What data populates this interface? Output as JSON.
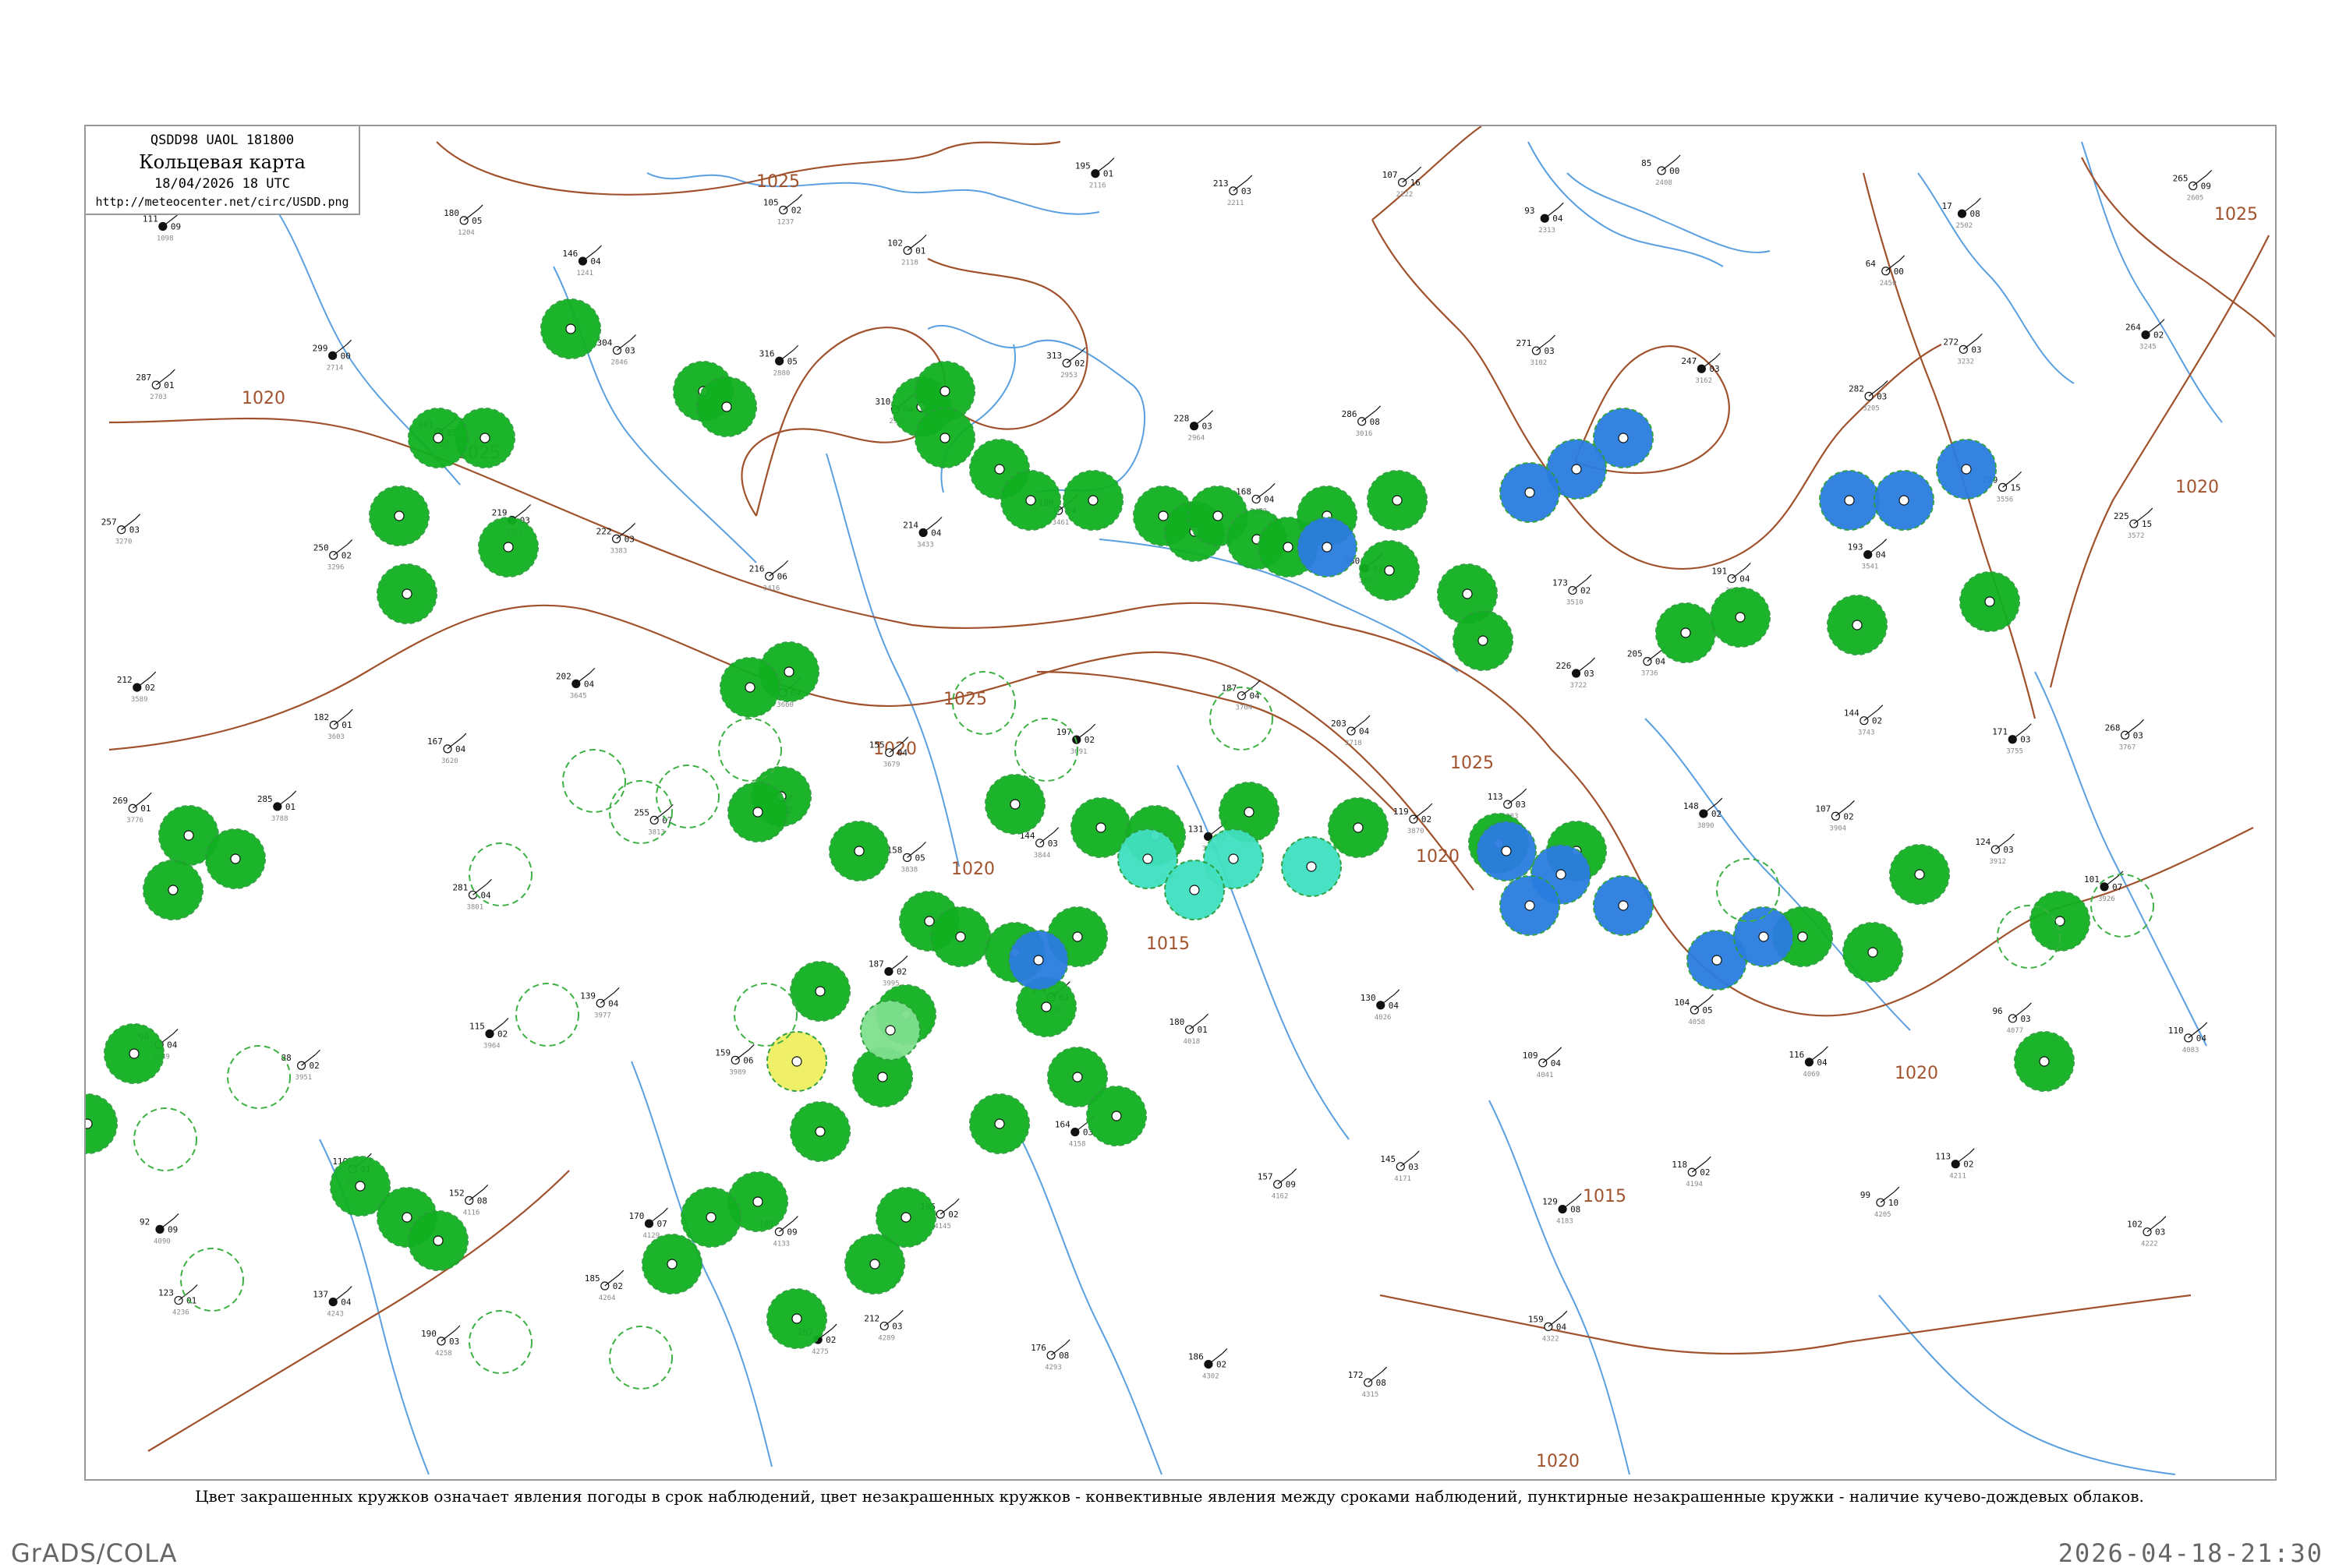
{
  "header": {
    "code": "QSDD98  UAOL  181800",
    "title": "Кольцевая карта",
    "date": "18/04/2026 18 UTC",
    "url": "http://meteocenter.net/circ/USDD.png"
  },
  "caption": "Цвет закрашенных кружков означает явления погоды в срок наблюдений, цвет незакрашенных кружков - конвективные явления между сроками наблюдений, пунктирные незакрашенные кружки - наличие кучево-дождевых облаков.",
  "footer": {
    "left": "GrADS/COLA",
    "right": "2026-04-18-21:30"
  },
  "colors": {
    "isobar": "#a0522d",
    "river": "#5aa0e0",
    "green": "#10b020",
    "blue": "#2a7de0",
    "cyan": "#40e0c0",
    "yellow": "#f0f060",
    "lightgreen": "#80e090"
  },
  "isobar_labels": [
    "1025",
    "1020",
    "1025",
    "1025",
    "1020",
    "1025",
    "1020",
    "1015",
    "1020",
    "1025",
    "1020",
    "1015",
    "1020",
    "1020"
  ],
  "stations": [
    {
      "t": "111",
      "p": "09",
      "id": "1098"
    },
    {
      "t": "140",
      "p": "04",
      "id": "1152"
    },
    {
      "t": "180",
      "p": "05",
      "id": "1204"
    },
    {
      "t": "146",
      "p": "04",
      "id": "1241"
    },
    {
      "t": "105",
      "p": "02",
      "id": "1237"
    },
    {
      "t": "102",
      "p": "01",
      "id": "2118"
    },
    {
      "t": "195",
      "p": "01",
      "id": "2116"
    },
    {
      "t": "213",
      "p": "03",
      "id": "2211"
    },
    {
      "t": "107",
      "p": "16",
      "id": "2222"
    },
    {
      "t": "93",
      "p": "04",
      "id": "2313"
    },
    {
      "t": "85",
      "p": "00",
      "id": "2408"
    },
    {
      "t": "64",
      "p": "00",
      "id": "2450"
    },
    {
      "t": "17",
      "p": "08",
      "id": "2502"
    },
    {
      "t": "265",
      "p": "09",
      "id": "2605"
    },
    {
      "t": "287",
      "p": "01",
      "id": "2703"
    },
    {
      "t": "299",
      "p": "00",
      "id": "2714"
    },
    {
      "t": "301",
      "p": "05",
      "id": "2832"
    },
    {
      "t": "304",
      "p": "03",
      "id": "2846"
    },
    {
      "t": "316",
      "p": "05",
      "id": "2880"
    },
    {
      "t": "310",
      "p": "04",
      "id": "2916"
    },
    {
      "t": "313",
      "p": "02",
      "id": "2953"
    },
    {
      "t": "228",
      "p": "03",
      "id": "2964"
    },
    {
      "t": "286",
      "p": "08",
      "id": "3016"
    },
    {
      "t": "271",
      "p": "03",
      "id": "3102"
    },
    {
      "t": "247",
      "p": "03",
      "id": "3162"
    },
    {
      "t": "282",
      "p": "03",
      "id": "3205"
    },
    {
      "t": "272",
      "p": "03",
      "id": "3232"
    },
    {
      "t": "264",
      "p": "02",
      "id": "3245"
    },
    {
      "t": "257",
      "p": "03",
      "id": "3270"
    },
    {
      "t": "250",
      "p": "02",
      "id": "3296"
    },
    {
      "t": "219",
      "p": "03",
      "id": "3320"
    },
    {
      "t": "222",
      "p": "03",
      "id": "3383"
    },
    {
      "t": "216",
      "p": "06",
      "id": "3416"
    },
    {
      "t": "214",
      "p": "04",
      "id": "3433"
    },
    {
      "t": "189",
      "p": "04",
      "id": "3461"
    },
    {
      "t": "168",
      "p": "04",
      "id": "3478"
    },
    {
      "t": "160",
      "p": "03",
      "id": "3496"
    },
    {
      "t": "173",
      "p": "02",
      "id": "3510"
    },
    {
      "t": "191",
      "p": "04",
      "id": "3528"
    },
    {
      "t": "193",
      "p": "04",
      "id": "3541"
    },
    {
      "t": "229",
      "p": "15",
      "id": "3556"
    },
    {
      "t": "225",
      "p": "15",
      "id": "3572"
    },
    {
      "t": "212",
      "p": "02",
      "id": "3589"
    },
    {
      "t": "182",
      "p": "01",
      "id": "3603"
    },
    {
      "t": "167",
      "p": "04",
      "id": "3620"
    },
    {
      "t": "202",
      "p": "04",
      "id": "3645"
    },
    {
      "t": "178",
      "p": "04",
      "id": "3660"
    },
    {
      "t": "155",
      "p": "04",
      "id": "3679"
    },
    {
      "t": "197",
      "p": "02",
      "id": "3691"
    },
    {
      "t": "187",
      "p": "04",
      "id": "3704"
    },
    {
      "t": "203",
      "p": "04",
      "id": "3718"
    },
    {
      "t": "226",
      "p": "03",
      "id": "3722"
    },
    {
      "t": "205",
      "p": "04",
      "id": "3736"
    },
    {
      "t": "144",
      "p": "02",
      "id": "3743"
    },
    {
      "t": "171",
      "p": "03",
      "id": "3755"
    },
    {
      "t": "268",
      "p": "03",
      "id": "3767"
    },
    {
      "t": "269",
      "p": "01",
      "id": "3776"
    },
    {
      "t": "285",
      "p": "01",
      "id": "3788"
    },
    {
      "t": "281",
      "p": "04",
      "id": "3801"
    },
    {
      "t": "255",
      "p": "07",
      "id": "3813"
    },
    {
      "t": "163",
      "p": "02",
      "id": "3826"
    },
    {
      "t": "158",
      "p": "05",
      "id": "3838"
    },
    {
      "t": "144",
      "p": "03",
      "id": "3844"
    },
    {
      "t": "131",
      "p": "02",
      "id": "3855"
    },
    {
      "t": "119",
      "p": "02",
      "id": "3870"
    },
    {
      "t": "113",
      "p": "03",
      "id": "3883"
    },
    {
      "t": "148",
      "p": "02",
      "id": "3890"
    },
    {
      "t": "107",
      "p": "02",
      "id": "3904"
    },
    {
      "t": "124",
      "p": "03",
      "id": "3912"
    },
    {
      "t": "101",
      "p": "07",
      "id": "3926"
    },
    {
      "t": "96",
      "p": "04",
      "id": "3939"
    },
    {
      "t": "88",
      "p": "02",
      "id": "3951"
    },
    {
      "t": "115",
      "p": "02",
      "id": "3964"
    },
    {
      "t": "139",
      "p": "04",
      "id": "3977"
    },
    {
      "t": "159",
      "p": "06",
      "id": "3989"
    },
    {
      "t": "187",
      "p": "02",
      "id": "3995"
    },
    {
      "t": "174",
      "p": "01",
      "id": "4002"
    },
    {
      "t": "180",
      "p": "01",
      "id": "4018"
    },
    {
      "t": "130",
      "p": "04",
      "id": "4026"
    },
    {
      "t": "109",
      "p": "04",
      "id": "4041"
    },
    {
      "t": "104",
      "p": "05",
      "id": "4058"
    },
    {
      "t": "116",
      "p": "04",
      "id": "4069"
    },
    {
      "t": "96",
      "p": "03",
      "id": "4077"
    },
    {
      "t": "110",
      "p": "04",
      "id": "4083"
    },
    {
      "t": "92",
      "p": "09",
      "id": "4090"
    },
    {
      "t": "110",
      "p": "01",
      "id": "4103"
    },
    {
      "t": "152",
      "p": "08",
      "id": "4116"
    },
    {
      "t": "170",
      "p": "07",
      "id": "4129"
    },
    {
      "t": "181",
      "p": "09",
      "id": "4133"
    },
    {
      "t": "195",
      "p": "02",
      "id": "4145"
    },
    {
      "t": "164",
      "p": "03",
      "id": "4158"
    },
    {
      "t": "157",
      "p": "09",
      "id": "4162"
    },
    {
      "t": "145",
      "p": "03",
      "id": "4171"
    },
    {
      "t": "129",
      "p": "08",
      "id": "4183"
    },
    {
      "t": "118",
      "p": "02",
      "id": "4194"
    },
    {
      "t": "99",
      "p": "10",
      "id": "4205"
    },
    {
      "t": "113",
      "p": "02",
      "id": "4211"
    },
    {
      "t": "102",
      "p": "03",
      "id": "4222"
    },
    {
      "t": "123",
      "p": "01",
      "id": "4236"
    },
    {
      "t": "137",
      "p": "04",
      "id": "4243"
    },
    {
      "t": "190",
      "p": "03",
      "id": "4258"
    },
    {
      "t": "185",
      "p": "02",
      "id": "4264"
    },
    {
      "t": "207",
      "p": "02",
      "id": "4275"
    },
    {
      "t": "212",
      "p": "03",
      "id": "4289"
    },
    {
      "t": "176",
      "p": "08",
      "id": "4293"
    },
    {
      "t": "186",
      "p": "02",
      "id": "4302"
    },
    {
      "t": "172",
      "p": "08",
      "id": "4315"
    },
    {
      "t": "159",
      "p": "04",
      "id": "4322"
    }
  ]
}
